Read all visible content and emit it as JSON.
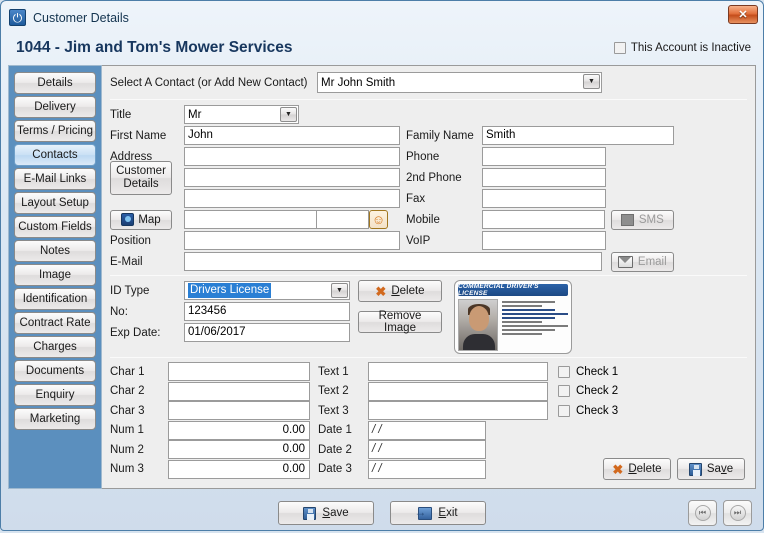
{
  "window": {
    "title": "Customer Details",
    "app_icon": "power-icon",
    "close_label": "✕"
  },
  "header": {
    "company_title": "1044 - Jim and Tom's Mower Services",
    "inactive_label": "This Account is Inactive",
    "inactive_checked": false
  },
  "sidebar": {
    "active": "Contacts",
    "items": [
      {
        "label": "Details"
      },
      {
        "label": "Delivery"
      },
      {
        "label": "Terms / Pricing"
      },
      {
        "label": "Contacts"
      },
      {
        "label": "E-Mail Links"
      },
      {
        "label": "Layout Setup"
      },
      {
        "label": "Custom Fields"
      },
      {
        "label": "Notes"
      },
      {
        "label": "Image"
      },
      {
        "label": "Identification"
      },
      {
        "label": "Contract Rate"
      },
      {
        "label": "Charges"
      },
      {
        "label": "Documents"
      },
      {
        "label": "Enquiry"
      },
      {
        "label": "Marketing"
      }
    ]
  },
  "contact_selector": {
    "label": "Select A Contact (or Add New Contact)",
    "value": "Mr John Smith"
  },
  "contact_form": {
    "left": {
      "title_label": "Title",
      "title_value": "Mr",
      "first_name_label": "First Name",
      "first_name_value": "John",
      "address_label": "Address",
      "address_line1": "",
      "address_line2": "",
      "address_line3": "",
      "address_city": "",
      "address_state": "",
      "position_label": "Position",
      "position_value": "",
      "email_label": "E-Mail",
      "email_value": "",
      "customer_details_line1": "Customer",
      "customer_details_line2": "Details",
      "map_label": "Map"
    },
    "right": {
      "family_name_label": "Family Name",
      "family_name_value": "Smith",
      "phone_label": "Phone",
      "phone_value": "",
      "phone2_label": "2nd Phone",
      "phone2_value": "",
      "fax_label": "Fax",
      "fax_value": "",
      "mobile_label": "Mobile",
      "mobile_value": "",
      "voip_label": "VoIP",
      "voip_value": "",
      "sms_label": "SMS",
      "email_label": "Email"
    }
  },
  "identification": {
    "id_type_label": "ID Type",
    "id_type_value": "Drivers License",
    "no_label": "No:",
    "no_value": "123456",
    "exp_date_label": "Exp Date:",
    "exp_date_value": "01/06/2017",
    "delete_label": "Delete",
    "remove_image_label": "Remove Image",
    "license_card_title": "COMMERCIAL DRIVER'S LICENSE"
  },
  "custom_fields": {
    "char_rows": [
      {
        "label": "Char 1",
        "value": ""
      },
      {
        "label": "Char 2",
        "value": ""
      },
      {
        "label": "Char 3",
        "value": ""
      }
    ],
    "num_rows": [
      {
        "label": "Num 1",
        "value": "0.00"
      },
      {
        "label": "Num 2",
        "value": "0.00"
      },
      {
        "label": "Num 3",
        "value": "0.00"
      }
    ],
    "text_rows": [
      {
        "label": "Text 1",
        "value": ""
      },
      {
        "label": "Text 2",
        "value": ""
      },
      {
        "label": "Text 3",
        "value": ""
      }
    ],
    "date_rows": [
      {
        "label": "Date 1",
        "value": "/ /"
      },
      {
        "label": "Date 2",
        "value": "/ /"
      },
      {
        "label": "Date 3",
        "value": "/ /"
      }
    ],
    "checks": [
      {
        "label": "Check 1",
        "checked": false
      },
      {
        "label": "Check 2",
        "checked": false
      },
      {
        "label": "Check 3",
        "checked": false
      }
    ],
    "delete_label": "Delete",
    "save_label": "Save"
  },
  "footer": {
    "save_label": "Save",
    "exit_label": "Exit",
    "nav_first": "⏮",
    "nav_last": "⏭"
  },
  "colors": {
    "sidebar_bg": "#5b8fbe",
    "title_text": "#17375e",
    "selection": "#2a7fd4",
    "accent_orange": "#d2691e"
  }
}
